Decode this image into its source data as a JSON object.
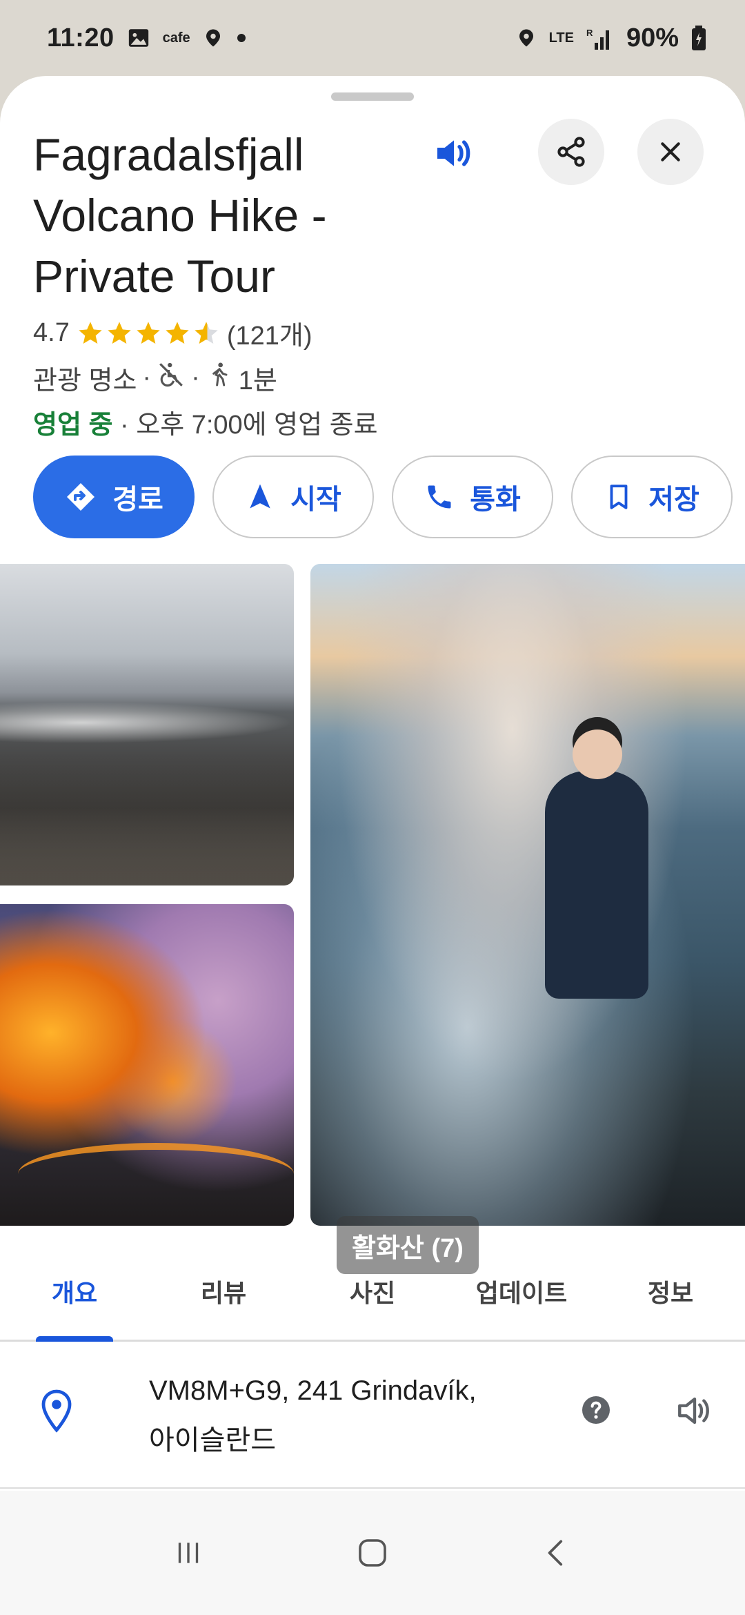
{
  "status_bar": {
    "time": "11:20",
    "app_label": "cafe",
    "network": "LTE",
    "battery": "90%"
  },
  "place": {
    "title": "Fagradalsfjall Volcano Hike - Private Tour",
    "rating": "4.7",
    "rating_value": 4.7,
    "review_count": "(121개)",
    "category": "관광 명소",
    "walk_time": "1분",
    "open_status": "영업 중",
    "closing_info": "· 오후 7:00에 영업 종료"
  },
  "actions": {
    "directions": "경로",
    "start": "시작",
    "call": "통화",
    "save": "저장"
  },
  "photos": {
    "label": "활화산 (7)"
  },
  "tabs": [
    "개요",
    "리뷰",
    "사진",
    "업데이트",
    "정보"
  ],
  "address": {
    "line1": "VM8M+G9, 241 Grindavík,",
    "line2": "아이슬란드"
  },
  "colors": {
    "accent": "#1a56db",
    "primary_button": "#2b6de6",
    "open_green": "#188038",
    "star": "#f4b400"
  }
}
